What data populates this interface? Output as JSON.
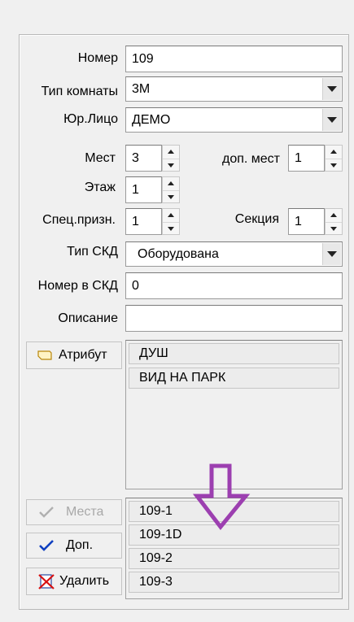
{
  "form": {
    "number_label": "Номер",
    "number_value": "109",
    "room_type_label": "Тип комнаты",
    "room_type_value": "3М",
    "legal_entity_label": "Юр.Лицо",
    "legal_entity_value": "ДЕМО",
    "seats_label": "Мест",
    "seats_value": "3",
    "extra_seats_label": "доп. мест",
    "extra_seats_value": "1",
    "floor_label": "Этаж",
    "floor_value": "1",
    "special_label": "Спец.призн.",
    "special_value": "1",
    "section_label": "Секция",
    "section_value": "1",
    "skd_type_label": "Тип СКД",
    "skd_type_value": "Оборудована",
    "skd_number_label": "Номер в СКД",
    "skd_number_value": "0",
    "description_label": "Описание",
    "description_value": ""
  },
  "attributes": {
    "button_label": "Атрибут",
    "items": [
      "ДУШ",
      "ВИД НА ПАРК"
    ]
  },
  "places": {
    "places_button_label": "Места",
    "add_button_label": "Доп.",
    "delete_button_label": "Удалить",
    "items": [
      "109-1",
      "109-1D",
      "109-2",
      "109-3"
    ]
  },
  "annotation": {
    "arrow_color": "#9c3fb0"
  }
}
